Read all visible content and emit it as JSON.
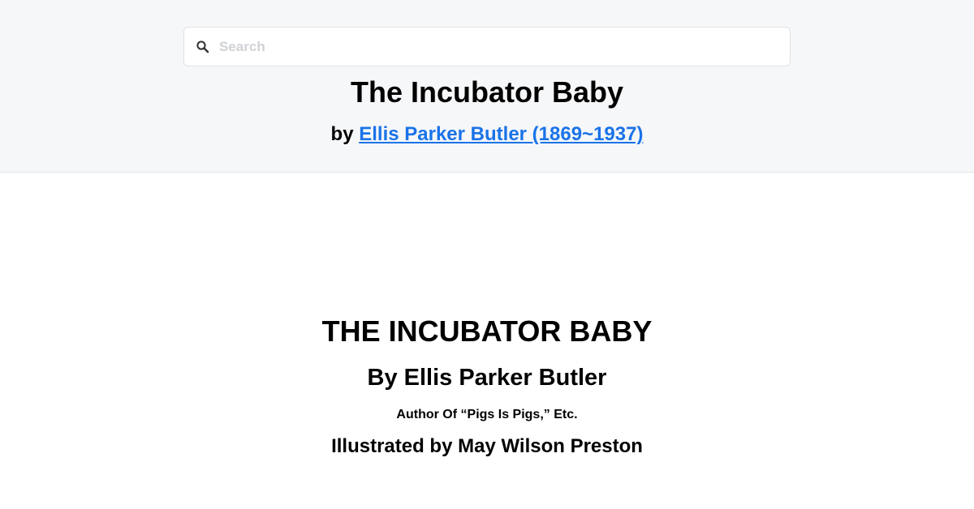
{
  "search": {
    "placeholder": "Search",
    "value": "",
    "icon": "search-icon"
  },
  "header": {
    "title": "The Incubator Baby",
    "byline_prefix": "by ",
    "author_link": "Ellis Parker Butler (1869~1937)",
    "link_color": "#1a73e8",
    "background": "#f6f7f9"
  },
  "book": {
    "title": "THE INCUBATOR BABY",
    "author": "By Ellis Parker Butler",
    "note": "Author Of “Pigs Is Pigs,” Etc.",
    "illustrator": "Illustrated by May Wilson Preston"
  }
}
